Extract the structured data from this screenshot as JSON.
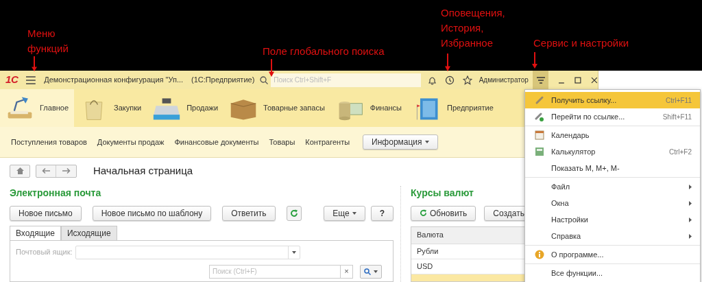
{
  "annotations": [
    {
      "lines": [
        "Меню",
        "функций"
      ],
      "kind": "menu"
    },
    {
      "lines": [
        "Поле глобального поиска"
      ],
      "kind": "search"
    },
    {
      "lines": [
        "Оповещения,",
        "История,",
        "Избранное"
      ],
      "kind": "notify"
    },
    {
      "lines": [
        "Сервис и настройки"
      ],
      "kind": "service"
    }
  ],
  "title_bar": {
    "logo": "1С",
    "title": "Демонстрационная конфигурация \"Уп...",
    "app": "(1С:Предприятие)",
    "search": {
      "placeholder": "Поиск Ctrl+Shift+F"
    },
    "user": "Администратор",
    "service_open": true
  },
  "sections": [
    {
      "label": "Главное",
      "kind": "lamp",
      "selected": true
    },
    {
      "label": "Закупки",
      "kind": "bag",
      "selected": false
    },
    {
      "label": "Продажи",
      "kind": "register",
      "selected": false
    },
    {
      "label": "Товарные запасы",
      "kind": "box",
      "selected": false
    },
    {
      "label": "Финансы",
      "kind": "coins",
      "selected": false
    },
    {
      "label": "Предприятие",
      "kind": "building",
      "selected": false
    }
  ],
  "nav_links": [
    "Поступления товаров",
    "Документы продаж",
    "Финансовые документы",
    "Товары",
    "Контрагенты"
  ],
  "nav_button": "Информация",
  "page_title": "Начальная страница",
  "email": {
    "title": "Электронная почта",
    "buttons": [
      "Новое письмо",
      "Новое письмо по шаблону",
      "Ответить"
    ],
    "more": "Еще",
    "help": "?",
    "tabs": [
      {
        "label": "Входящие",
        "selected": true
      },
      {
        "label": "Исходящие",
        "selected": false
      }
    ],
    "mailbox_label": "Почтовый ящик:",
    "search": {
      "placeholder": "Поиск (Ctrl+F)"
    },
    "clear": "×"
  },
  "currency": {
    "title": "Курсы валют",
    "refresh": "Обновить",
    "create": "Создать",
    "column_1": "Валюта",
    "rows": [
      {
        "cell": "Рубли",
        "selected": false
      },
      {
        "cell": "USD",
        "selected": false
      },
      {
        "cell": "",
        "selected": true
      }
    ]
  },
  "service_menu": {
    "groups": [
      [
        {
          "label": "Получить ссылку...",
          "shortcut": "Ctrl+F11",
          "kind": "link",
          "selected": true
        },
        {
          "label": "Перейти по ссылке...",
          "shortcut": "Shift+F11",
          "kind": "goto",
          "selected": false
        }
      ],
      [
        {
          "label": "Календарь",
          "kind": "calendar",
          "selected": false
        },
        {
          "label": "Калькулятор",
          "shortcut": "Ctrl+F2",
          "kind": "calculator",
          "selected": false
        },
        {
          "label": "Показать М, М+, М-",
          "kind": "plain",
          "selected": false
        }
      ],
      [
        {
          "label": "Файл",
          "kind": "submenu",
          "selected": false
        },
        {
          "label": "Окна",
          "kind": "submenu",
          "selected": false
        },
        {
          "label": "Настройки",
          "kind": "submenu",
          "selected": false
        },
        {
          "label": "Справка",
          "kind": "submenu",
          "selected": false
        }
      ],
      [
        {
          "label": "О программе...",
          "kind": "info",
          "selected": false
        }
      ],
      [
        {
          "label": "Все функции...",
          "kind": "plain",
          "selected": false
        }
      ]
    ]
  }
}
